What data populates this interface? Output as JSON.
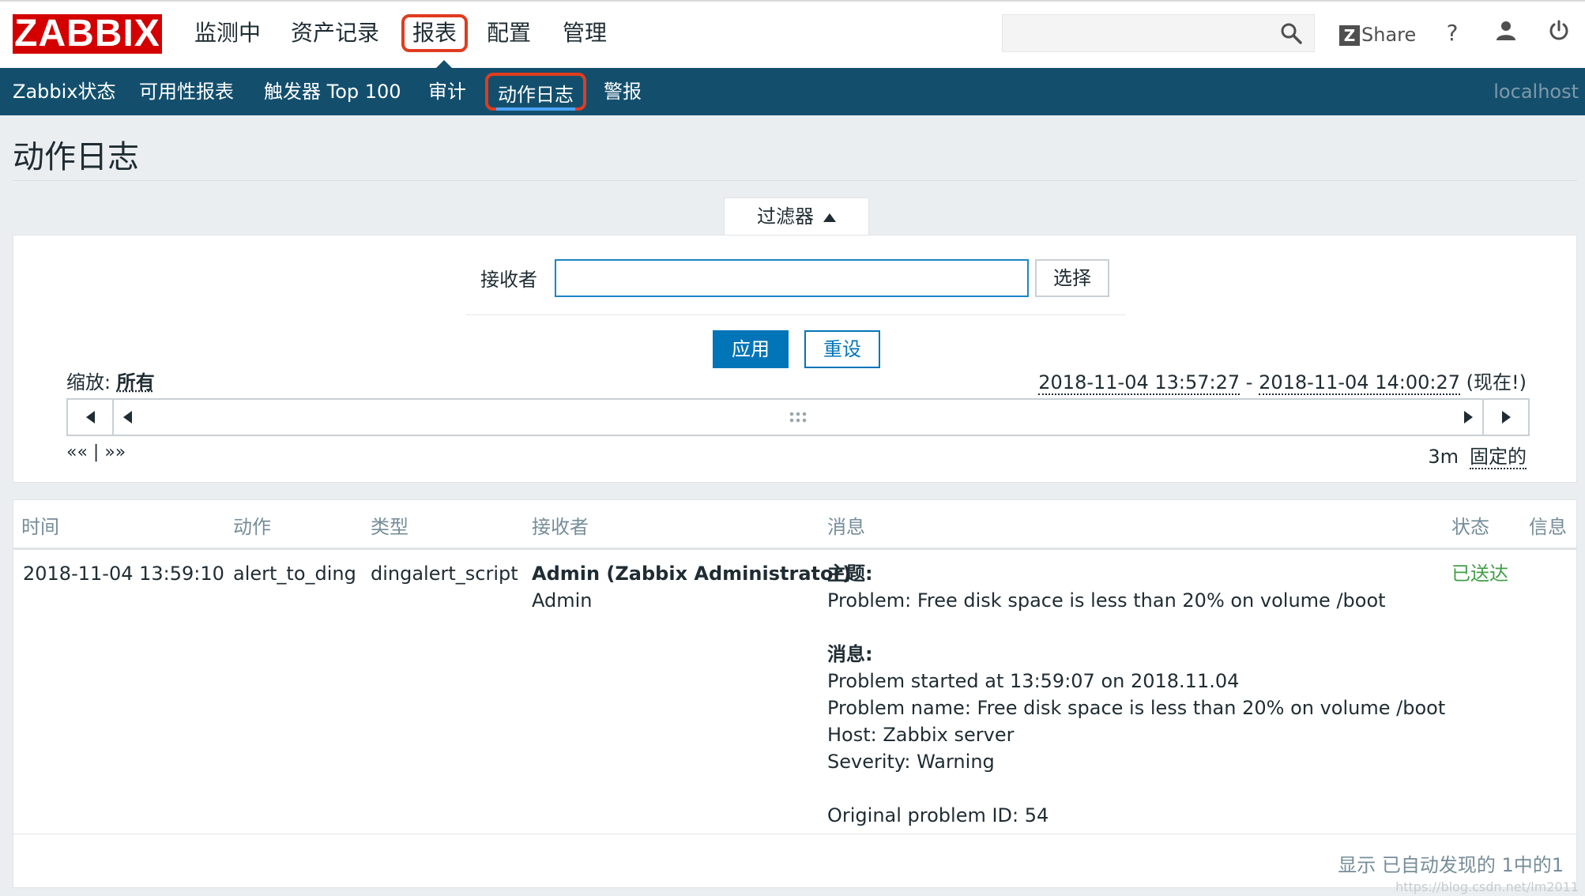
{
  "brand": {
    "logo": "ZABBIX",
    "logo_color": "#d40000"
  },
  "main_nav": [
    {
      "label": "监测中"
    },
    {
      "label": "资产记录"
    },
    {
      "label": "报表",
      "active": true
    },
    {
      "label": "配置"
    },
    {
      "label": "管理"
    }
  ],
  "top_right": {
    "share_icon_letter": "Z",
    "share_label": "Share",
    "help": "?",
    "search_icon": "search-icon",
    "user_icon": "user-icon",
    "power_icon": "power-icon"
  },
  "sub_nav": {
    "items": [
      {
        "label": "Zabbix状态"
      },
      {
        "label": "可用性报表"
      },
      {
        "label": "触发器 Top 100"
      },
      {
        "label": "审计"
      },
      {
        "label": "动作日志",
        "active": true
      },
      {
        "label": "警报"
      }
    ],
    "host": "localhost",
    "bg_color": "#134f6d"
  },
  "page": {
    "title": "动作日志"
  },
  "filter": {
    "tab_label": "过滤器",
    "recipient_label": "接收者",
    "recipient_value": "",
    "select_button": "选择",
    "apply_button": "应用",
    "reset_button": "重设",
    "zoom_label": "缩放:",
    "zoom_value": "所有",
    "period_from": "2018-11-04 13:57:27",
    "period_sep": " - ",
    "period_to": "2018-11-04 14:00:27",
    "period_now": "(现在!)",
    "nav_back": "«« | »»",
    "span": "3m",
    "fixed_label": "固定的"
  },
  "table": {
    "columns": [
      "时间",
      "动作",
      "类型",
      "接收者",
      "消息",
      "状态",
      "信息"
    ],
    "rows": [
      {
        "time": "2018-11-04 13:59:10",
        "action": "alert_to_ding",
        "type": "dingalert_script",
        "recipient_name": "Admin (Zabbix Administrator)",
        "recipient_user": "Admin",
        "subject_label": "主题:",
        "subject": "Problem: Free disk space is less than 20% on volume /boot",
        "message_label": "消息:",
        "message_lines": [
          "Problem started at 13:59:07 on 2018.11.04",
          "Problem name: Free disk space is less than 20% on volume /boot",
          "Host: Zabbix server",
          "Severity: Warning",
          "",
          "Original problem ID: 54"
        ],
        "status": "已送达",
        "status_color": "#429e47"
      }
    ],
    "footer": "显示 已自动发现的 1中的1"
  },
  "watermark": "https://blog.csdn.net/lm2011"
}
